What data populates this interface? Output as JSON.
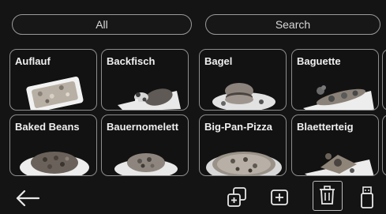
{
  "filter": {
    "all_label": "All",
    "search_label": "Search"
  },
  "recipes": [
    {
      "label": "Auflauf",
      "icon": "casserole-photo"
    },
    {
      "label": "Backfisch",
      "icon": "fried-fish-photo"
    },
    {
      "label": "Bagel",
      "icon": "bagel-photo"
    },
    {
      "label": "Baguette",
      "icon": "baguette-photo"
    },
    {
      "label": "Baked Beans",
      "icon": "baked-beans-photo"
    },
    {
      "label": "Bauernomelett",
      "icon": "omelette-photo"
    },
    {
      "label": "Big-Pan-Pizza",
      "icon": "pizza-photo"
    },
    {
      "label": "Blaetterteig",
      "icon": "puff-pastry-photo"
    }
  ],
  "toolbar": {
    "back_icon": "arrow-left-icon",
    "copy_icon": "copy-plus-icon",
    "add_icon": "add-square-icon",
    "delete_icon": "trash-icon",
    "usb_icon": "usb-stick-icon"
  },
  "colors": {
    "background": "#141414",
    "border": "#8e8e8e",
    "text": "#f0f0f0"
  }
}
